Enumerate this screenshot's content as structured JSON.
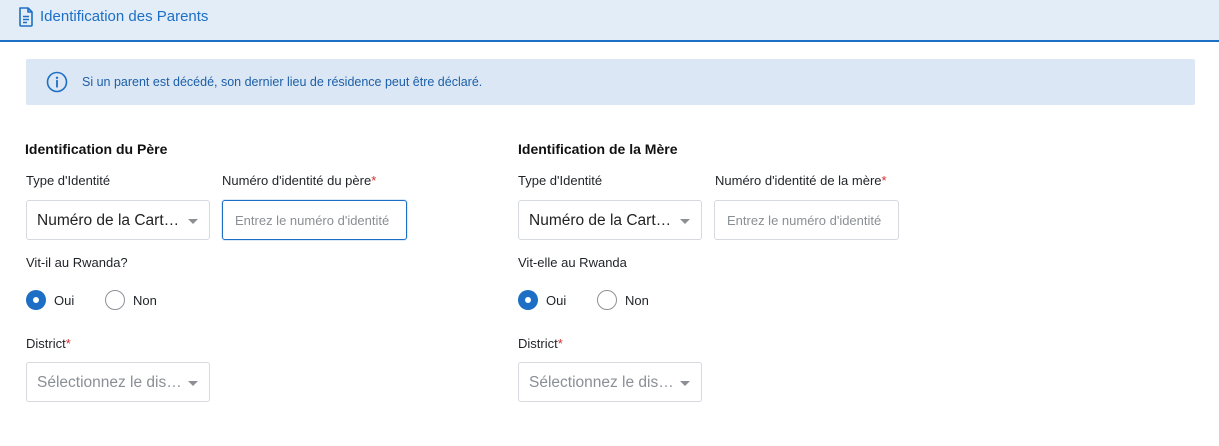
{
  "section": {
    "title": "Identification des Parents",
    "icon": "document-icon"
  },
  "banner": {
    "icon": "info-circle-icon",
    "text": "Si un parent est décédé, son dernier lieu de résidence peut être déclaré."
  },
  "father": {
    "heading": "Identification du Père",
    "id_type_label": "Type d'Identité",
    "id_type_value": "Numéro de la Carte d'Identité",
    "id_number_label": "Numéro d'identité du père",
    "id_number_placeholder": "Entrez le numéro d'identité",
    "lives_label": "Vit-il au Rwanda?",
    "option_yes": "Oui",
    "option_no": "Non",
    "selected": "Oui",
    "district_label": "District",
    "district_placeholder": "Sélectionnez le district"
  },
  "mother": {
    "heading": "Identification de la Mère",
    "id_type_label": "Type d'Identité",
    "id_type_value": "Numéro de la Carte d'Identité",
    "id_number_label": "Numéro d'identité de la mère",
    "id_number_placeholder": "Entrez le numéro d'identité",
    "lives_label": "Vit-elle au Rwanda",
    "option_yes": "Oui",
    "option_no": "Non",
    "selected": "Oui",
    "district_label": "District",
    "district_placeholder": "Sélectionnez le district"
  },
  "required_marker": "*",
  "colors": {
    "accent": "#1c6fc4",
    "header_bg": "#e3edf8",
    "banner_bg": "#dbe7f5",
    "required": "#d62b2b"
  }
}
